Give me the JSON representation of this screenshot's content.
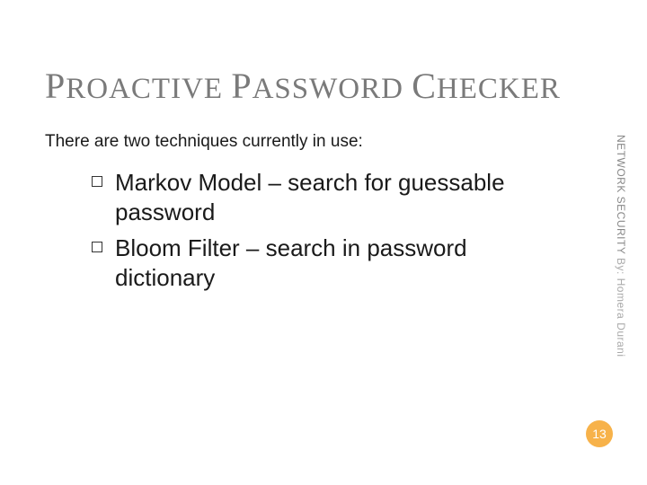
{
  "title": {
    "word1_cap": "P",
    "word1_rest": "ROACTIVE ",
    "word2_cap": "P",
    "word2_rest": "ASSWORD ",
    "word3_cap": "C",
    "word3_rest": "HECKER"
  },
  "intro": "There are two techniques currently in use:",
  "bullets": [
    "Markov Model – search for guessable password",
    "Bloom Filter – search in password dictionary"
  ],
  "side_label": {
    "main": "NETWORK SECURITY ",
    "by": " By: Homera Durani"
  },
  "page_number": "13",
  "colors": {
    "title_gray": "#7a7a7a",
    "accent_orange": "#f7b24a"
  }
}
